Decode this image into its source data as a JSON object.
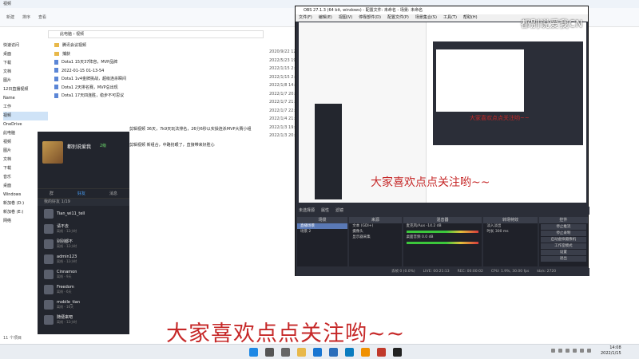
{
  "explorer": {
    "title": "视频",
    "address": "此电脑 › 视频",
    "toolbar": [
      "新建",
      "排序",
      "查看"
    ],
    "nav": [
      "快速访问",
      "桌面",
      "下载",
      "文档",
      "图片",
      "12日直播视频",
      "Name",
      "工作",
      "视频",
      "OneDrive",
      "此电脑",
      "视频",
      "图片",
      "文档",
      "下载",
      "音乐",
      "桌面",
      "Windows",
      "新加卷 (D:)",
      "新加卷 (E:)",
      "网络"
    ],
    "files": [
      "腾讯会议视频",
      "捕获",
      "Dota1 15天37阵容，MVP品牌",
      "2022-01-15 01-13-54",
      "Dota1 1v4金牌挑战，超级连杀瞬间",
      "Dota1 2天排名赛，MVP总出现",
      "Dota1 17天四连胜，稳步不可思议",
      "剪辑视频 36天，7k9天玩法排名，26分6秒以实操连杀MVP大赛小组",
      "剪辑视频 新组合，中路抢眼了，直接带来好胜心"
    ],
    "dates": [
      "2020/9/22 12:07",
      "2022/5/23 19:00",
      "2022/1/15 2:44",
      "2022/1/15 2:44",
      "2022/1/8 14:09",
      "2022/1/7 20:00",
      "2022/1/7 21:00",
      "2022/1/7 22:00",
      "2022/1/4 21:00",
      "2022/1/3 19:00",
      "2022/1/3 20:00"
    ],
    "status": "11 个项目"
  },
  "chat": {
    "user": "都别说爱我",
    "badge": "2级",
    "tabs": [
      "群",
      "好友",
      "消息"
    ],
    "group_label": "我的好友 1/19",
    "contacts": [
      {
        "name": "Tian_wi11_tell",
        "status": ""
      },
      {
        "name": "请不去",
        "status": "离线 - 12小时"
      },
      {
        "name": "别别都不",
        "status": "离线 - 12小时"
      },
      {
        "name": "admin123",
        "status": "离线 - 12小时"
      },
      {
        "name": "Cinnamon",
        "status": "离线 - 9天"
      },
      {
        "name": "Freedom",
        "status": "离线 - 6天"
      },
      {
        "name": "mobile_tian",
        "status": "离线 - 16天"
      },
      {
        "name": "随便来吧",
        "status": "离线 - 12小时"
      }
    ]
  },
  "obs": {
    "title": "OBS 27.1.3 (64 bit, windows) - 配置文件: 未命名 - 场景: 未命名",
    "menu": [
      "文件(F)",
      "编辑(E)",
      "视图(V)",
      "停靠部件(D)",
      "配置文件(P)",
      "场景集合(S)",
      "工具(T)",
      "帮助(H)"
    ],
    "strip": [
      "未选择源",
      "属性",
      "滤镜"
    ],
    "docks": {
      "scenes": {
        "title": "场景",
        "items": [
          "直播场景",
          "场景 2"
        ]
      },
      "sources": {
        "title": "来源",
        "items": [
          "文本 (GDI+)",
          "摄像头",
          "显示器采集"
        ]
      },
      "mixer": {
        "title": "混音器",
        "tracks": [
          {
            "name": "麦克风/Aux",
            "db": "-14.2 dB"
          },
          {
            "name": "桌面音频",
            "db": "0.0 dB"
          }
        ]
      },
      "transitions": {
        "title": "转场特效",
        "mode": "淡入淡出",
        "duration_label": "时长",
        "duration": "300 ms"
      },
      "controls": {
        "title": "控件",
        "buttons": [
          "停止推流",
          "停止录制",
          "启动虚拟摄像机",
          "工作室模式",
          "设置",
          "退出"
        ]
      }
    },
    "status": [
      "丢帧 0 (0.0%)",
      "LIVE: 00:21:13",
      "REC: 00:00:02",
      "CPU: 1.9%, 30.00 fps",
      "kb/s: 2720"
    ],
    "preview_overlay": "大家喜欢点点关注哟~~",
    "nested_overlay": "大家喜欢点点关注哟~~"
  },
  "watermark": "都别说爱我CN",
  "overlay": "大家喜欢点点关注哟~~",
  "taskbar": {
    "time": "14:08",
    "date": "2022/1/15"
  },
  "colors": {
    "overlay": "#c62828",
    "obs_bg": "#2b2e38"
  }
}
